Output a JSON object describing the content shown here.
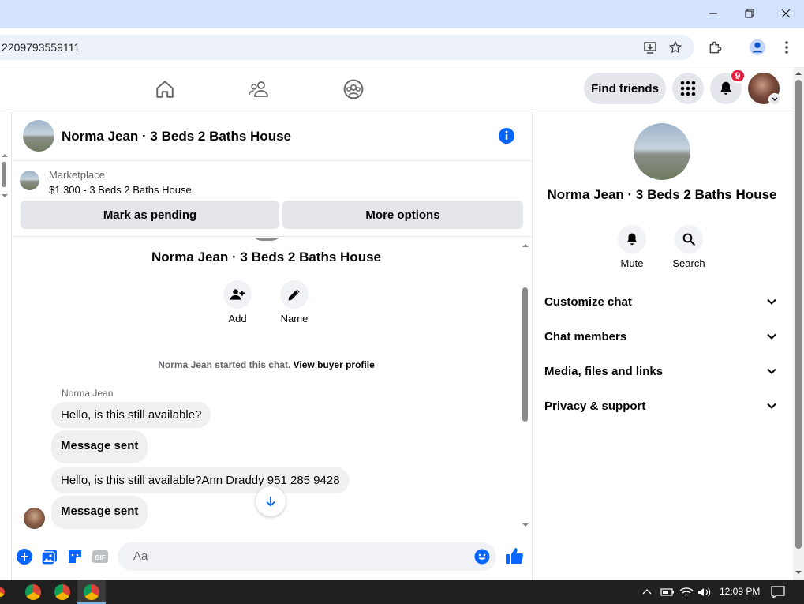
{
  "browser": {
    "url": "2209793559111"
  },
  "header": {
    "find_friends": "Find friends",
    "notification_count": "9"
  },
  "conversation": {
    "title": "Norma Jean · 3 Beds 2 Baths House",
    "marketplace_label": "Marketplace",
    "listing": "$1,300 - 3 Beds 2 Baths House",
    "mark_pending": "Mark as pending",
    "more_options": "More options",
    "profile_name": "Norma Jean · 3 Beds 2 Baths House",
    "add_label": "Add",
    "name_label": "Name",
    "started_text": "Norma Jean started this chat.",
    "view_buyer": "View buyer profile",
    "sender": "Norma Jean",
    "messages": [
      "Hello, is this still available?",
      "Message sent",
      "Hello, is this still available?Ann Draddy 951 285 9428",
      "Message sent"
    ],
    "composer_placeholder": "Aa"
  },
  "info_panel": {
    "title": "Norma Jean · 3 Beds 2 Baths House",
    "mute": "Mute",
    "search": "Search",
    "sections": [
      "Customize chat",
      "Chat members",
      "Media, files and links",
      "Privacy & support"
    ]
  },
  "taskbar": {
    "time": "12:09 PM"
  },
  "colors": {
    "accent": "#0866ff",
    "badge": "#e41e3f",
    "bubble": "#f0f0f0"
  }
}
